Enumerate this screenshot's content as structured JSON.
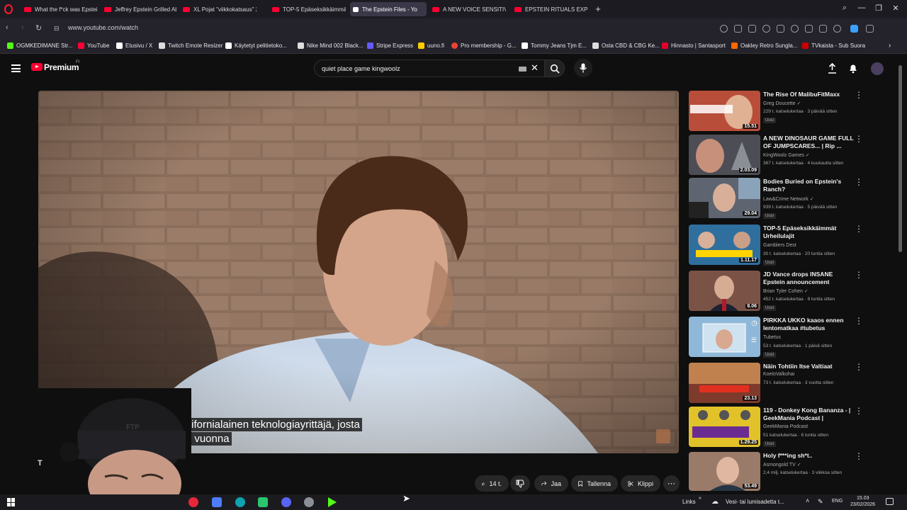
{
  "browser": {
    "tabs": [
      {
        "label": "What the f*ck was Epstein"
      },
      {
        "label": "Jeffrey Epstein Grilled Ab"
      },
      {
        "label": "XL Pojat \"viikkokatsaus\" 2"
      },
      {
        "label": "TOP-5 Epäseksikkäimmät"
      },
      {
        "label": "The Epstein Files - Yo",
        "active": true
      },
      {
        "label": "A NEW VOICE SENSITIVE"
      },
      {
        "label": "EPSTEIN RITUALS EXPOSE"
      }
    ],
    "new_tab_label": "+",
    "url": "www.youtube.com/watch",
    "bookmarks": [
      {
        "label": "OGMKEDIMANE Str...",
        "color": "#53fc18"
      },
      {
        "label": "YouTube",
        "color": "#ff0033"
      },
      {
        "label": "Etusivu / X",
        "color": "#ffffff"
      },
      {
        "label": "Twitch Emote Resizer",
        "color": "#dddddd"
      },
      {
        "label": "Käytetyt pelitietoko...",
        "color": "#ffffff"
      },
      {
        "label": "Nike Mind 002 Black...",
        "color": "#dddddd"
      },
      {
        "label": "Stripe Express",
        "color": "#635bff"
      },
      {
        "label": "uuno.fi",
        "color": "#ffcc00"
      },
      {
        "label": "Pro membership - G...",
        "color": "#ea4335"
      },
      {
        "label": "Tommy Jeans Tjm E...",
        "color": "#ffffff"
      },
      {
        "label": "Osta CBD & CBG Ke...",
        "color": "#dddddd"
      },
      {
        "label": "Hinnasto | Santasport",
        "color": "#e4002b"
      },
      {
        "label": "Oakley Retro Sungla...",
        "color": "#ff6600"
      },
      {
        "label": "TVkaista - Sub Suora",
        "color": "#cc0000"
      }
    ]
  },
  "youtube": {
    "logo_text": "Premium",
    "logo_region": "FI",
    "search_value": "quiet place game kingwoolz",
    "caption_line1": "kalifornialainen teknologiayrittäjä, josta",
    "caption_line2": "tuli vuonna",
    "actions": {
      "like_count": "14 t.",
      "share": "Jaa",
      "save": "Tallenna",
      "clip": "Klippi"
    },
    "recommendations": [
      {
        "title": "The Rise Of MalibuFitMaxx",
        "channel": "Greg Doucette",
        "meta": "229 t. katselukertaa · 3 päivää sitten",
        "badge": "Uusi",
        "duration": "15.51",
        "verified": true,
        "thumb_color": "#b84e3a"
      },
      {
        "title": "A NEW DINOSAUR GAME FULL OF JUMPSCARES... | Rip ...",
        "channel": "KingWoolz Games",
        "meta": "367 t. katselukertaa · 4 kuukautta sitten",
        "badge": "",
        "duration": "2.03.09",
        "verified": true,
        "thumb_color": "#4d4d55"
      },
      {
        "title": "Bodies Buried on Epstein's Ranch?",
        "channel": "Law&Crime Network",
        "meta": "939 t. katselukertaa · 5 päivää sitten",
        "badge": "Uusi",
        "duration": "29.04",
        "verified": true,
        "thumb_color": "#5e6470"
      },
      {
        "title": "TOP-5 Epäseksikkäimmät Urheilulajit",
        "channel": "Gamblers Dest",
        "meta": "30 t. katselukertaa · 20 tuntia sitten",
        "badge": "Uusi",
        "duration": "1.11.17",
        "verified": false,
        "thumb_color": "#2f6f9e"
      },
      {
        "title": "JD Vance drops INSANE Epstein announcement",
        "channel": "Brian Tyler Cohen",
        "meta": "452 t. katselukertaa · 8 tuntia sitten",
        "badge": "Uusi",
        "duration": "8.06",
        "verified": true,
        "thumb_color": "#7a5346"
      },
      {
        "title": "PIRKKA UKKO kaaos ennen lentomatkaa #tubetus",
        "channel": "Tubetus",
        "meta": "53 t. katselukertaa · 1 päivä sitten",
        "badge": "Uusi",
        "duration": "",
        "verified": false,
        "thumb_color": "#8fb8d8"
      },
      {
        "title": "Näin Tohtiin Itse Valtiaat",
        "channel": "KoeloValkohai",
        "meta": "73 t. katselukertaa · 3 vuotta sitten",
        "badge": "",
        "duration": "23.13",
        "verified": false,
        "thumb_color": "#7e3a2a"
      },
      {
        "title": "119 - Donkey Kong Bananza - | GeekMania Podcast |",
        "channel": "GeekMania Podcast",
        "meta": "51 katselukertaa · 6 tuntia sitten",
        "badge": "Uusi",
        "duration": "1.29.25",
        "verified": false,
        "thumb_color": "#e2c229"
      },
      {
        "title": "Holy f***ing sh*t..",
        "channel": "Asmongold TV",
        "meta": "2,4 milj. katselukertaa · 3 viikkoa sitten",
        "badge": "",
        "duration": "53.49",
        "verified": true,
        "thumb_color": "#9a7a68"
      }
    ]
  },
  "webcam": {
    "hat_text": "FTP",
    "side_letter": "T"
  },
  "taskbar": {
    "links_label": "Links",
    "weather": "Vesi- tai lumisadetta t...",
    "language": "ENG",
    "time": "15.03",
    "date": "23/02/2026"
  }
}
